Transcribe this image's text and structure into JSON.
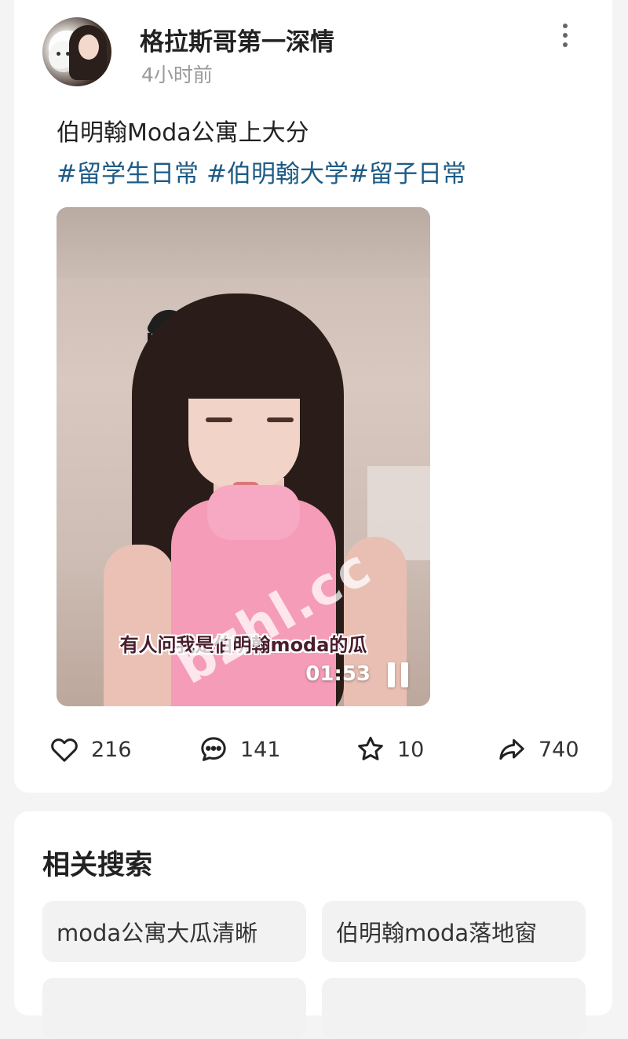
{
  "post": {
    "username": "格拉斯哥第一深情",
    "timestamp": "4小时前",
    "text": "伯明翰Moda公寓上大分",
    "hashtags": [
      "#留学生日常",
      "#伯明翰大学",
      "#留子日常"
    ]
  },
  "video": {
    "subtitle": "有人问我是伯明翰moda的瓜",
    "duration": "01:53",
    "watermark": "bzhl.cc"
  },
  "actions": {
    "likes": "216",
    "comments": "141",
    "favorites": "10",
    "shares": "740"
  },
  "related": {
    "title": "相关搜索",
    "items": [
      "moda公寓大瓜清晰",
      "伯明翰moda落地窗",
      "",
      ""
    ]
  },
  "colors": {
    "hashtag": "#1d5b86",
    "background": "#f4f4f4",
    "chip": "#f2f2f2"
  },
  "icons": [
    "more-vertical-icon",
    "heart-icon",
    "comment-icon",
    "star-icon",
    "share-icon",
    "pause-icon"
  ]
}
